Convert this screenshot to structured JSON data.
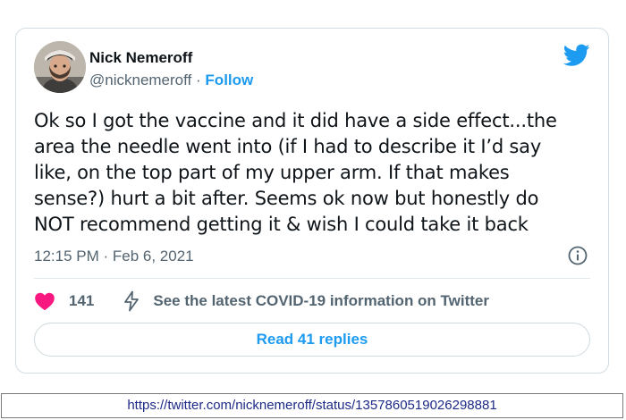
{
  "tweet": {
    "author": {
      "name": "Nick Nemeroff",
      "handle": "@nicknemeroff",
      "separator": "·",
      "follow_label": "Follow",
      "avatar_icon": "user-avatar"
    },
    "brand_icon": "twitter-bird-icon",
    "brand_color": "#1d9bf0",
    "text_lines": [
      "Ok so I got the vaccine and it did have a side effect...the",
      "area the needle went into (if I had to describe it I’d say",
      "like, on the top part of my upper arm. If that makes",
      "sense?) hurt a bit after. Seems ok now but honestly do",
      "NOT recommend getting it & wish I could take it back"
    ],
    "timestamp": "12:15 PM · Feb 6, 2021",
    "info_icon": "info-icon",
    "actions": {
      "like_icon": "heart-icon",
      "like_color": "#f91880",
      "like_count": "141",
      "covid_icon": "lightning-bolt-icon",
      "covid_link": "See the latest COVID-19 information on Twitter"
    },
    "replies_button": "Read 41 replies"
  },
  "source_url": "https://twitter.com/nicknemeroff/status/1357860519026298881"
}
